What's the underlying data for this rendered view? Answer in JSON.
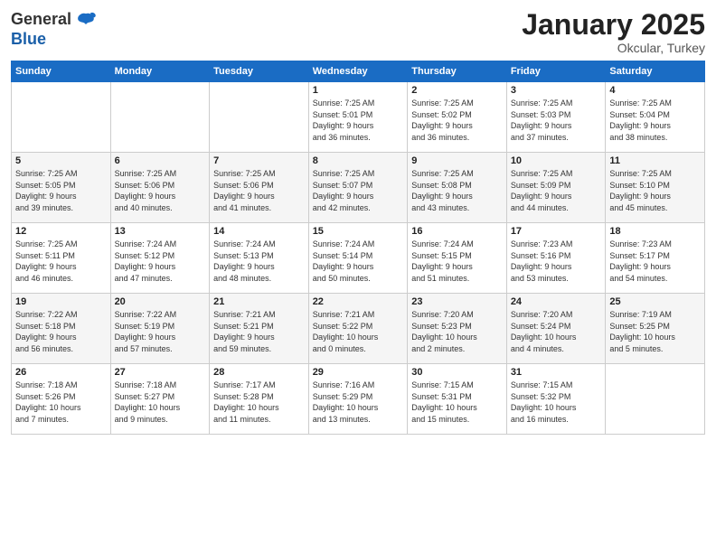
{
  "logo": {
    "general": "General",
    "blue": "Blue"
  },
  "header": {
    "month": "January 2025",
    "location": "Okcular, Turkey"
  },
  "weekdays": [
    "Sunday",
    "Monday",
    "Tuesday",
    "Wednesday",
    "Thursday",
    "Friday",
    "Saturday"
  ],
  "weeks": [
    [
      {
        "day": "",
        "info": ""
      },
      {
        "day": "",
        "info": ""
      },
      {
        "day": "",
        "info": ""
      },
      {
        "day": "1",
        "info": "Sunrise: 7:25 AM\nSunset: 5:01 PM\nDaylight: 9 hours\nand 36 minutes."
      },
      {
        "day": "2",
        "info": "Sunrise: 7:25 AM\nSunset: 5:02 PM\nDaylight: 9 hours\nand 36 minutes."
      },
      {
        "day": "3",
        "info": "Sunrise: 7:25 AM\nSunset: 5:03 PM\nDaylight: 9 hours\nand 37 minutes."
      },
      {
        "day": "4",
        "info": "Sunrise: 7:25 AM\nSunset: 5:04 PM\nDaylight: 9 hours\nand 38 minutes."
      }
    ],
    [
      {
        "day": "5",
        "info": "Sunrise: 7:25 AM\nSunset: 5:05 PM\nDaylight: 9 hours\nand 39 minutes."
      },
      {
        "day": "6",
        "info": "Sunrise: 7:25 AM\nSunset: 5:06 PM\nDaylight: 9 hours\nand 40 minutes."
      },
      {
        "day": "7",
        "info": "Sunrise: 7:25 AM\nSunset: 5:06 PM\nDaylight: 9 hours\nand 41 minutes."
      },
      {
        "day": "8",
        "info": "Sunrise: 7:25 AM\nSunset: 5:07 PM\nDaylight: 9 hours\nand 42 minutes."
      },
      {
        "day": "9",
        "info": "Sunrise: 7:25 AM\nSunset: 5:08 PM\nDaylight: 9 hours\nand 43 minutes."
      },
      {
        "day": "10",
        "info": "Sunrise: 7:25 AM\nSunset: 5:09 PM\nDaylight: 9 hours\nand 44 minutes."
      },
      {
        "day": "11",
        "info": "Sunrise: 7:25 AM\nSunset: 5:10 PM\nDaylight: 9 hours\nand 45 minutes."
      }
    ],
    [
      {
        "day": "12",
        "info": "Sunrise: 7:25 AM\nSunset: 5:11 PM\nDaylight: 9 hours\nand 46 minutes."
      },
      {
        "day": "13",
        "info": "Sunrise: 7:24 AM\nSunset: 5:12 PM\nDaylight: 9 hours\nand 47 minutes."
      },
      {
        "day": "14",
        "info": "Sunrise: 7:24 AM\nSunset: 5:13 PM\nDaylight: 9 hours\nand 48 minutes."
      },
      {
        "day": "15",
        "info": "Sunrise: 7:24 AM\nSunset: 5:14 PM\nDaylight: 9 hours\nand 50 minutes."
      },
      {
        "day": "16",
        "info": "Sunrise: 7:24 AM\nSunset: 5:15 PM\nDaylight: 9 hours\nand 51 minutes."
      },
      {
        "day": "17",
        "info": "Sunrise: 7:23 AM\nSunset: 5:16 PM\nDaylight: 9 hours\nand 53 minutes."
      },
      {
        "day": "18",
        "info": "Sunrise: 7:23 AM\nSunset: 5:17 PM\nDaylight: 9 hours\nand 54 minutes."
      }
    ],
    [
      {
        "day": "19",
        "info": "Sunrise: 7:22 AM\nSunset: 5:18 PM\nDaylight: 9 hours\nand 56 minutes."
      },
      {
        "day": "20",
        "info": "Sunrise: 7:22 AM\nSunset: 5:19 PM\nDaylight: 9 hours\nand 57 minutes."
      },
      {
        "day": "21",
        "info": "Sunrise: 7:21 AM\nSunset: 5:21 PM\nDaylight: 9 hours\nand 59 minutes."
      },
      {
        "day": "22",
        "info": "Sunrise: 7:21 AM\nSunset: 5:22 PM\nDaylight: 10 hours\nand 0 minutes."
      },
      {
        "day": "23",
        "info": "Sunrise: 7:20 AM\nSunset: 5:23 PM\nDaylight: 10 hours\nand 2 minutes."
      },
      {
        "day": "24",
        "info": "Sunrise: 7:20 AM\nSunset: 5:24 PM\nDaylight: 10 hours\nand 4 minutes."
      },
      {
        "day": "25",
        "info": "Sunrise: 7:19 AM\nSunset: 5:25 PM\nDaylight: 10 hours\nand 5 minutes."
      }
    ],
    [
      {
        "day": "26",
        "info": "Sunrise: 7:18 AM\nSunset: 5:26 PM\nDaylight: 10 hours\nand 7 minutes."
      },
      {
        "day": "27",
        "info": "Sunrise: 7:18 AM\nSunset: 5:27 PM\nDaylight: 10 hours\nand 9 minutes."
      },
      {
        "day": "28",
        "info": "Sunrise: 7:17 AM\nSunset: 5:28 PM\nDaylight: 10 hours\nand 11 minutes."
      },
      {
        "day": "29",
        "info": "Sunrise: 7:16 AM\nSunset: 5:29 PM\nDaylight: 10 hours\nand 13 minutes."
      },
      {
        "day": "30",
        "info": "Sunrise: 7:15 AM\nSunset: 5:31 PM\nDaylight: 10 hours\nand 15 minutes."
      },
      {
        "day": "31",
        "info": "Sunrise: 7:15 AM\nSunset: 5:32 PM\nDaylight: 10 hours\nand 16 minutes."
      },
      {
        "day": "",
        "info": ""
      }
    ]
  ]
}
